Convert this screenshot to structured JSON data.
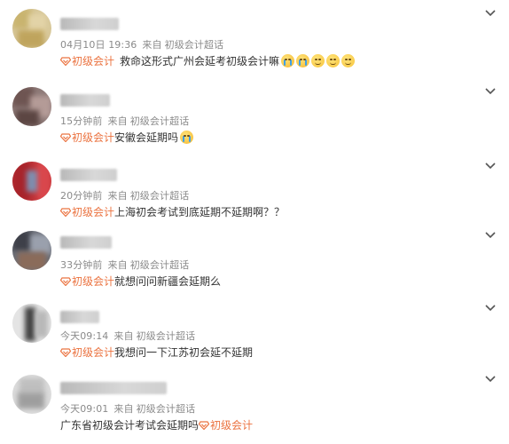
{
  "posts": [
    {
      "time": "04月10日 19:36",
      "source_prefix": "来自",
      "source": "初级会计超话",
      "topic_tag": "初级会计",
      "text": "救命这形式广州会延考初级会计嘛",
      "emojis": [
        "crying-face",
        "crying-face",
        "smiling-face",
        "smiling-face",
        "smiling-face"
      ]
    },
    {
      "time": "15分钟前",
      "source_prefix": "来自",
      "source": "初级会计超话",
      "topic_tag": "初级会计",
      "text": "安徽会延期吗",
      "emojis": [
        "crying-face"
      ]
    },
    {
      "time": "20分钟前",
      "source_prefix": "来自",
      "source": "初级会计超话",
      "topic_tag": "初级会计",
      "text": "上海初会考试到底延期不延期啊？？",
      "emojis": []
    },
    {
      "time": "33分钟前",
      "source_prefix": "来自",
      "source": "初级会计超话",
      "topic_tag": "初级会计",
      "text": "就想问问新疆会延期么",
      "emojis": []
    },
    {
      "time": "今天09:14",
      "source_prefix": "来自",
      "source": "初级会计超话",
      "topic_tag": "初级会计",
      "text": "我想问一下江苏初会延不延期",
      "emojis": []
    },
    {
      "time": "今天09:01",
      "source_prefix": "来自",
      "source": "初级会计超话",
      "topic_tag": "初级会计",
      "text": "广东省初级会计考试会延期吗",
      "emojis": []
    }
  ],
  "colors": {
    "topic": "#eb7340",
    "meta": "#8a8a8a",
    "text": "#333333",
    "chevron": "#555555"
  },
  "icons": {
    "chevron": "chevron-down-icon",
    "topic": "super-topic-diamond-icon"
  }
}
